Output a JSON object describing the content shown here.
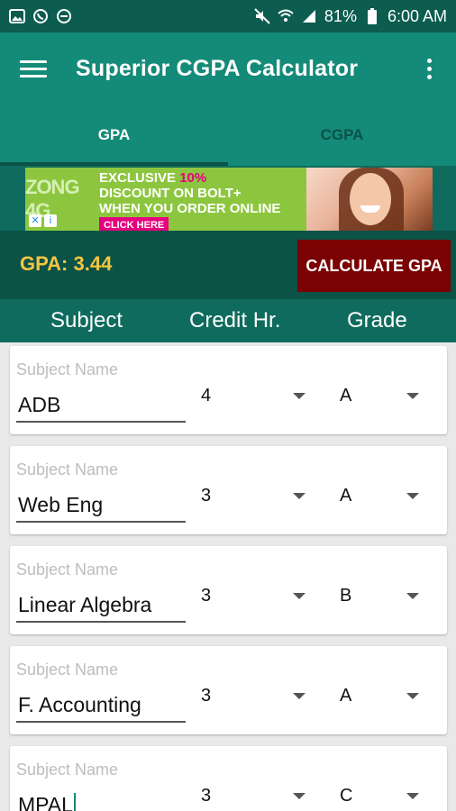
{
  "status_bar": {
    "battery": "81%",
    "time": "6:00 AM",
    "left_icons": [
      "image-icon",
      "whatsapp-icon",
      "dnd-icon"
    ],
    "right_icons": [
      "mute-icon",
      "wifi-icon",
      "signal-icon",
      "battery-icon"
    ]
  },
  "app_bar": {
    "title": "Superior CGPA Calculator"
  },
  "tabs": [
    {
      "label": "GPA",
      "active": true
    },
    {
      "label": "CGPA",
      "active": false
    }
  ],
  "ad": {
    "brand": "ZONG 4G",
    "line1": "EXCLUSIVE ",
    "line1_highlight": "10%",
    "line2": "DISCOUNT ON BOLT+",
    "line3": "WHEN YOU ORDER ONLINE",
    "cta": "CLICK HERE"
  },
  "gpa": {
    "label": "GPA: 3.44",
    "calculate_label": "CALCULATE GPA"
  },
  "table_header": {
    "subject": "Subject",
    "credit": "Credit Hr.",
    "grade": "Grade"
  },
  "subjects": [
    {
      "hint": "Subject Name",
      "name": "ADB",
      "credit": "4",
      "grade": "A"
    },
    {
      "hint": "Subject Name",
      "name": "Web Eng",
      "credit": "3",
      "grade": "A"
    },
    {
      "hint": "Subject Name",
      "name": "Linear Algebra",
      "credit": "3",
      "grade": "B"
    },
    {
      "hint": "Subject Name",
      "name": "F. Accounting",
      "credit": "3",
      "grade": "A"
    },
    {
      "hint": "Subject Name",
      "name": "MPAL",
      "credit": "3",
      "grade": "C"
    }
  ],
  "colors": {
    "primary": "#148a78",
    "primary_dark": "#0b5247",
    "accent_gpa": "#f4c542",
    "button": "#7a0202"
  }
}
